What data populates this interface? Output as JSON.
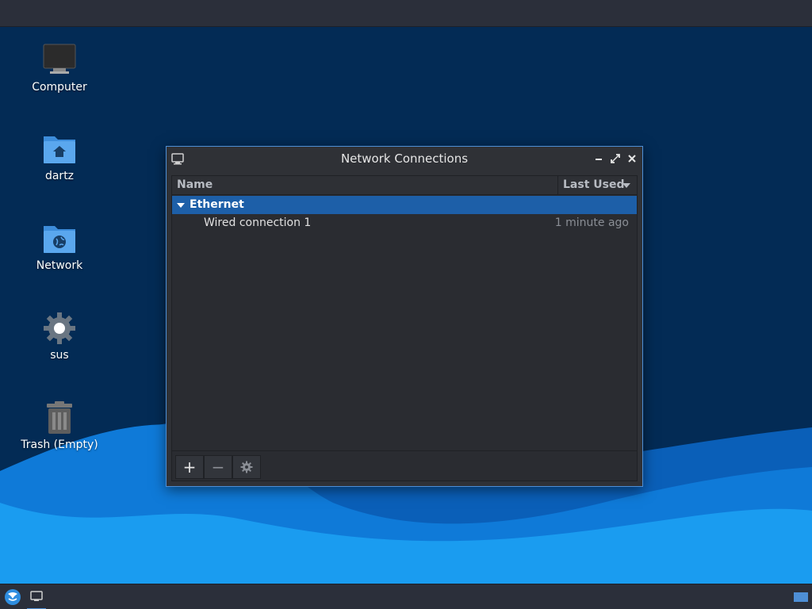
{
  "desktop": {
    "icons": [
      {
        "label": "Computer",
        "icon": "monitor-icon"
      },
      {
        "label": "dartz",
        "icon": "home-folder-icon"
      },
      {
        "label": "Network",
        "icon": "network-folder-icon"
      },
      {
        "label": "sus",
        "icon": "gear-icon"
      },
      {
        "label": "Trash (Empty)",
        "icon": "trash-icon"
      }
    ]
  },
  "window": {
    "title": "Network Connections",
    "icon": "network-connections-icon",
    "controls": {
      "minimize": "minimize-icon",
      "maximize": "maximize-icon",
      "close": "close-icon"
    }
  },
  "table": {
    "columns": {
      "name": "Name",
      "last_used": "Last Used"
    },
    "sort": "descending",
    "group": {
      "label": "Ethernet",
      "expanded": true
    },
    "connections": [
      {
        "name": "Wired connection 1",
        "last_used": "1 minute ago"
      }
    ]
  },
  "toolbar": {
    "add": "+",
    "remove": "−",
    "settings": "gear-icon"
  },
  "colors": {
    "accent": "#4e8fd6",
    "selected_row": "#1d5fa8",
    "desktop_bg": "#032b55",
    "wave_light": "#1a9cf0"
  }
}
